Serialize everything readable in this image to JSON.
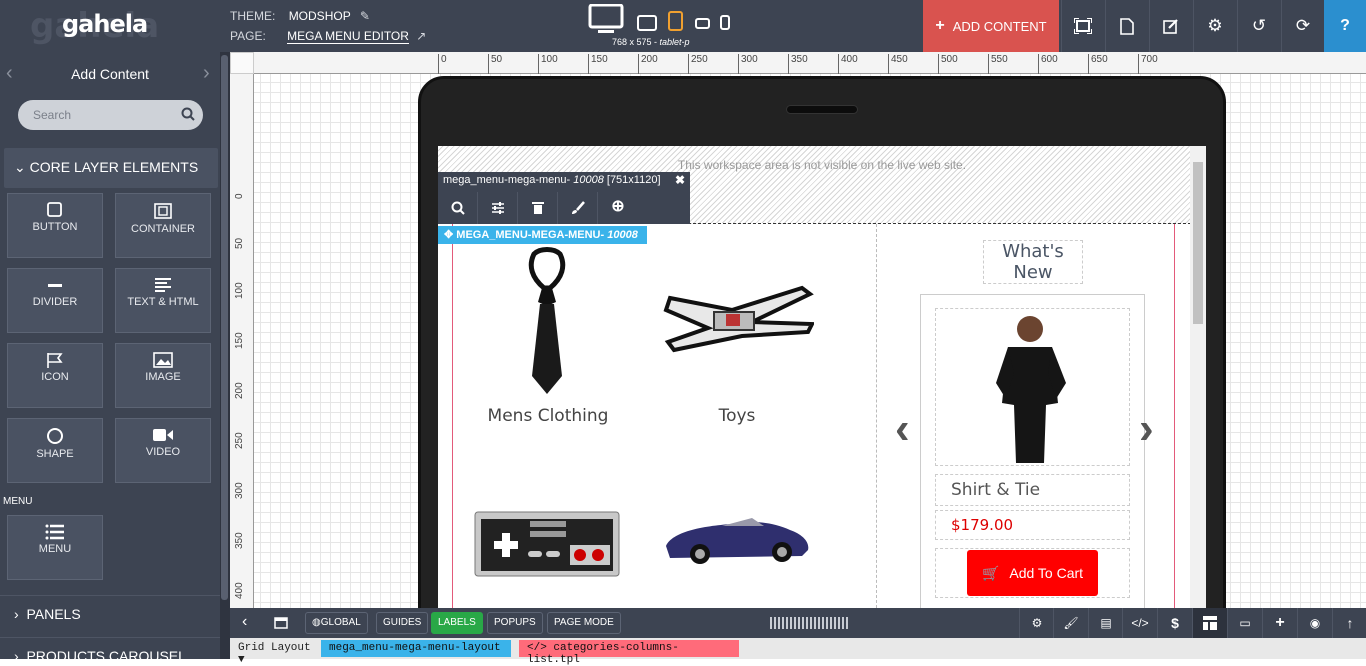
{
  "app": {
    "logo": "gahela",
    "logo_ghost": "gahela"
  },
  "header": {
    "theme_label": "THEME:",
    "theme_value": "MODSHOP",
    "page_label": "PAGE:",
    "page_value": "MEGA MENU EDITOR",
    "device_info": "768 x 575 - ",
    "device_mode": "tablet-p",
    "add_content": "ADD CONTENT",
    "icons": [
      "frame-icon",
      "file-icon",
      "edit-icon",
      "gear-icon",
      "undo-icon",
      "refresh-icon",
      "help-icon"
    ]
  },
  "sidebar": {
    "title": "Add Content",
    "search_placeholder": "Search",
    "section": "CORE LAYER ELEMENTS",
    "elements": [
      {
        "label": "BUTTON",
        "icon": "button-icon"
      },
      {
        "label": "CONTAINER",
        "icon": "container-icon"
      },
      {
        "label": "DIVIDER",
        "icon": "divider-icon"
      },
      {
        "label": "TEXT & HTML",
        "icon": "text-icon"
      },
      {
        "label": "ICON",
        "icon": "flag-icon"
      },
      {
        "label": "IMAGE",
        "icon": "image-icon"
      },
      {
        "label": "SHAPE",
        "icon": "circle-icon"
      },
      {
        "label": "VIDEO",
        "icon": "video-icon"
      }
    ],
    "menu_group": "MENU",
    "menu_item": "MENU",
    "panels": "PANELS",
    "products_carousel": "PRODUCTS CAROUSEL"
  },
  "ruler": {
    "top": [
      "0",
      "50",
      "100",
      "150",
      "200",
      "250",
      "300",
      "350",
      "400",
      "450",
      "500",
      "550",
      "600",
      "650",
      "700"
    ],
    "left": [
      "0",
      "50",
      "100",
      "150",
      "200",
      "250",
      "300",
      "350",
      "400"
    ]
  },
  "canvas": {
    "workspace_note": "This workspace area is not visible on the live web site.",
    "element_name": "mega_menu-mega-menu- ",
    "element_id": "10008",
    "element_size": " [751x1120]",
    "tag_label": "MEGA_MENU-MEGA-MENU- ",
    "tag_id": "10008"
  },
  "menu": {
    "categories": [
      "Mens Clothing",
      "Toys"
    ],
    "whats_new": "What's New",
    "product": {
      "name": "Shirt & Tie",
      "price": "$179.00",
      "cart": "Add To Cart"
    }
  },
  "bottombar": {
    "buttons": [
      "GLOBAL",
      "GUIDES",
      "LABELS",
      "POPUPS",
      "PAGE MODE"
    ],
    "active": "LABELS"
  },
  "breadcrumbs": {
    "layout": "Grid Layout",
    "node1": "mega_menu-mega-menu-layout",
    "node2": "categories-columns-list.tpl"
  },
  "colors": {
    "dark": "#3d4452",
    "accent_red": "#d9534f",
    "help_blue": "#2b8fcf",
    "tag_blue": "#3ab3ea",
    "active_green": "#29a847",
    "price_red": "#dd0000",
    "cart_red": "#ff0000",
    "device_orange": "#f0a030"
  }
}
